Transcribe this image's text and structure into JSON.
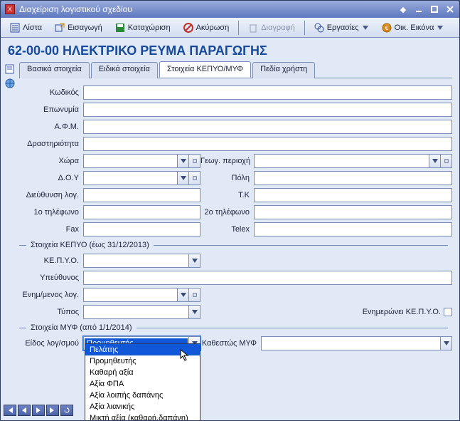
{
  "window": {
    "title": "Διαχείριση λογιστικού σχεδίου"
  },
  "toolbar": {
    "list": "Λίστα",
    "import": "Εισαγωγή",
    "save": "Καταχώριση",
    "cancel": "Ακύρωση",
    "delete": "Διαγραφή",
    "tasks": "Εργασίες",
    "finview": "Οικ. Εικόνα"
  },
  "heading": "62-00-00 ΗΛΕΚΤΡΙΚΟ ΡΕΥΜΑ ΠΑΡΑΓΩΓΗΣ",
  "tabs": {
    "basic": "Βασικά στοιχεία",
    "special": "Ειδικά στοιχεία",
    "kepyo": "Στοιχεία ΚΕΠΥΟ/ΜΥΦ",
    "user": "Πεδία χρήστη"
  },
  "labels": {
    "code": "Κωδικός",
    "name": "Επωνυμία",
    "afm": "Α.Φ.Μ.",
    "activity": "Δραστηριότητα",
    "country": "Χώρα",
    "geo": "Γεωγ. περιοχή",
    "doy": "Δ.Ο.Υ",
    "city": "Πόλη",
    "addr": "Διεύθυνση λογ.",
    "zip": "Τ.Κ",
    "tel1": "1ο τηλέφωνο",
    "tel2": "2ο τηλέφωνο",
    "fax": "Fax",
    "telex": "Telex",
    "kepyo_group": "Στοιχεία ΚΕΠΥΟ (έως 31/12/2013)",
    "kepyo": "ΚΕ.Π.Υ.Ο.",
    "owner": "Υπεύθυνος",
    "updacc": "Ενημ/μενος λογ.",
    "type": "Τύπος",
    "updates_kepyo": "Ενημερώνει ΚΕ.Π.Υ.Ο.",
    "myf_group": "Στοιχεία ΜΥΦ (από 1/1/2014)",
    "acctype": "Είδος λογ/σμού",
    "myf_status": "Καθεστώς ΜΥΦ"
  },
  "acctype_value": "Προμηθευτής",
  "dropdown": [
    "Πελάτης",
    "Προμηθευτής",
    "Καθαρή αξία",
    "Αξία ΦΠΑ",
    "Αξία λοιπής δαπάνης",
    "Αξία λιανικής",
    "Μικτή αξία (καθαρή,δαπάνη)"
  ]
}
